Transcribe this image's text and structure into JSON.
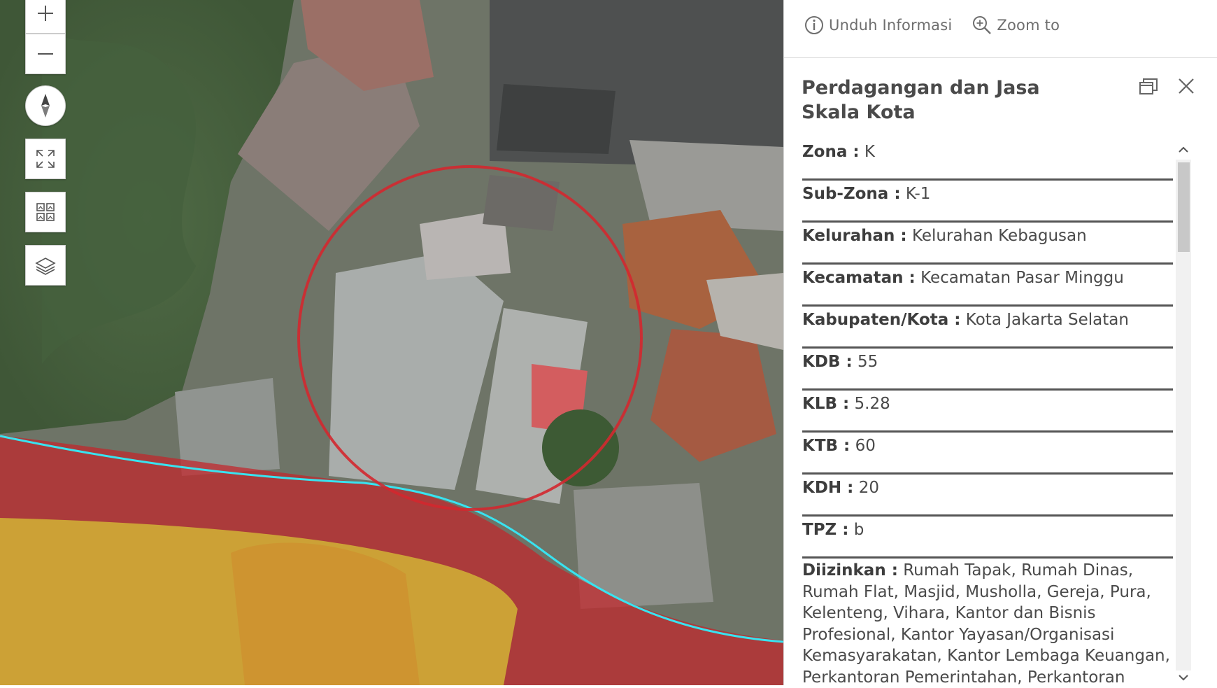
{
  "map": {
    "zoom_in_label": "+",
    "zoom_out_label": "—",
    "colors": {
      "aerial_base": "#6f7466",
      "zone_red": "#c4262b",
      "zone_yellow": "#d7c436",
      "boundary_cyan": "#38e3f0",
      "highlight_circle": "#d3282f"
    },
    "tools": [
      "zoom-in-icon",
      "zoom-out-icon",
      "compass-icon",
      "fullscreen-icon",
      "basemap-gallery-icon",
      "layers-icon"
    ]
  },
  "popup": {
    "actions": [
      {
        "label": "Unduh Informasi",
        "icon": "info-icon"
      },
      {
        "label": "Zoom to",
        "icon": "zoom-magnifier-icon"
      }
    ],
    "title": "Perdagangan dan Jasa Skala Kota",
    "attributes": [
      {
        "key": "Zona :",
        "value": "K"
      },
      {
        "key": "Sub-Zona :",
        "value": "K-1"
      },
      {
        "key": "Kelurahan :",
        "value": "Kelurahan Kebagusan"
      },
      {
        "key": "Kecamatan :",
        "value": "Kecamatan Pasar Minggu"
      },
      {
        "key": "Kabupaten/Kota :",
        "value": "Kota Jakarta Selatan"
      },
      {
        "key": "KDB :",
        "value": "55"
      },
      {
        "key": "KLB :",
        "value": "5.28"
      },
      {
        "key": "KTB :",
        "value": "60"
      },
      {
        "key": "KDH :",
        "value": "20"
      },
      {
        "key": "TPZ :",
        "value": "b"
      }
    ],
    "allowed": {
      "key": "Diizinkan :",
      "value": "Rumah Tapak, Rumah Dinas, Rumah Flat, Masjid, Musholla, Gereja, Pura, Kelenteng, Vihara, Kantor dan Bisnis Profesional, Kantor Yayasan/Organisasi Kemasyarakatan, Kantor Lembaga Keuangan, Perkantoran Pemerintahan, Perkantoran"
    }
  }
}
